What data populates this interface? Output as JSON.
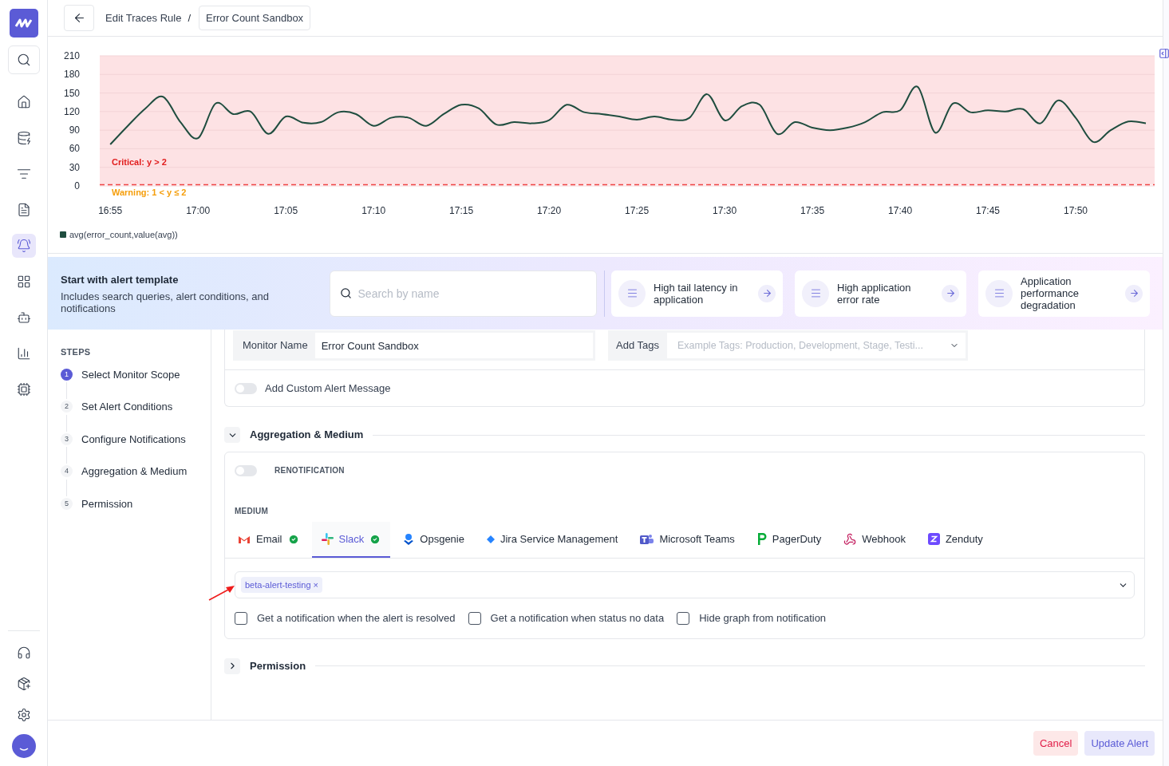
{
  "sidebar": {
    "items": [
      {
        "kind": "search",
        "selected": false
      },
      {
        "kind": "home",
        "selected": false
      },
      {
        "kind": "database",
        "selected": false
      },
      {
        "kind": "logs",
        "selected": false
      },
      {
        "kind": "file",
        "selected": false
      },
      {
        "kind": "alerts",
        "selected": true
      },
      {
        "kind": "dashboards",
        "selected": false
      },
      {
        "kind": "bot",
        "selected": false
      },
      {
        "kind": "reports",
        "selected": false
      },
      {
        "kind": "chip",
        "selected": false
      }
    ],
    "bottom_items": [
      {
        "kind": "support"
      },
      {
        "kind": "package"
      },
      {
        "kind": "settings"
      },
      {
        "kind": "avatar"
      }
    ]
  },
  "header": {
    "breadcrumb": "Edit Traces Rule",
    "separator": "/",
    "title": "Error Count Sandbox"
  },
  "chart_data": {
    "type": "line",
    "categories": [
      "16:55",
      null,
      null,
      null,
      null,
      "17:00",
      null,
      null,
      null,
      null,
      "17:05",
      null,
      null,
      null,
      null,
      "17:10",
      null,
      null,
      null,
      null,
      "17:15",
      null,
      null,
      null,
      null,
      "17:20",
      null,
      null,
      null,
      null,
      "17:25",
      null,
      null,
      null,
      null,
      "17:30",
      null,
      null,
      null,
      null,
      "17:35",
      null,
      null,
      null,
      null,
      "17:40",
      null,
      null,
      null,
      null,
      "17:45",
      null,
      null,
      null,
      null,
      "17:50",
      null,
      null,
      null,
      null
    ],
    "series": [
      {
        "name": "avg(error_count,value(avg))",
        "color": "#1f4d3f",
        "values": [
          67,
          97,
          125,
          144,
          103,
          77,
          133,
          116,
          120,
          84,
          112,
          102,
          103,
          119,
          116,
          97,
          110,
          110,
          97,
          116,
          131,
          125,
          99,
          103,
          101,
          106,
          131,
          119,
          116,
          112,
          107,
          112,
          107,
          110,
          148,
          106,
          129,
          131,
          84,
          103,
          94,
          90,
          94,
          103,
          119,
          122,
          160,
          86,
          133,
          119,
          122,
          120,
          124,
          101,
          138,
          110,
          71,
          90,
          104,
          101
        ]
      }
    ],
    "ylim": [
      0,
      210
    ],
    "yticks": [
      0,
      30,
      60,
      90,
      120,
      150,
      180,
      210
    ],
    "grid": true,
    "annotations": [
      "Critical: y > 2",
      "Warning: 1 < y ≤ 2"
    ]
  },
  "template": {
    "title": "Start with alert template",
    "description": "Includes search queries, alert conditions, and notifications",
    "search_placeholder": "Search by name",
    "items": [
      "High tail latency in application",
      "High application error rate",
      "Application performance degradation"
    ]
  },
  "steps": {
    "title": "STEPS",
    "items": [
      {
        "number": "1",
        "label": "Select Monitor Scope",
        "selected": true
      },
      {
        "number": "2",
        "label": "Set Alert Conditions",
        "selected": false
      },
      {
        "number": "3",
        "label": "Configure Notifications",
        "selected": false
      },
      {
        "number": "4",
        "label": "Aggregation & Medium",
        "selected": false
      },
      {
        "number": "5",
        "label": "Permission",
        "selected": false
      }
    ]
  },
  "monitor_name": {
    "label": "Monitor Name",
    "value": "Error Count Sandbox"
  },
  "tags": {
    "label": "Add Tags",
    "placeholder": "Example Tags: Production, Development, Stage, Testi..."
  },
  "custom_message": {
    "label": "Add Custom Alert Message",
    "on": false
  },
  "aggregation": {
    "title": "Aggregation & Medium",
    "expanded": true
  },
  "renotification": {
    "label": "RENOTIFICATION",
    "on": false
  },
  "medium": {
    "label": "MEDIUM"
  },
  "channels": [
    {
      "kind": "email",
      "name": "Email",
      "configured": true,
      "selected": false
    },
    {
      "kind": "slack",
      "name": "Slack",
      "configured": true,
      "selected": true
    },
    {
      "kind": "opsgenie",
      "name": "Opsgenie",
      "configured": false,
      "selected": false
    },
    {
      "kind": "jira",
      "name": "Jira Service Management",
      "configured": false,
      "selected": false
    },
    {
      "kind": "teams",
      "name": "Microsoft Teams",
      "configured": false,
      "selected": false
    },
    {
      "kind": "pagerduty",
      "name": "PagerDuty",
      "configured": false,
      "selected": false
    },
    {
      "kind": "webhook",
      "name": "Webhook",
      "configured": false,
      "selected": false
    },
    {
      "kind": "zenduty",
      "name": "Zenduty",
      "configured": false,
      "selected": false
    }
  ],
  "channel_select": {
    "chips": [
      {
        "label": "beta-alert-testing",
        "remove": "×"
      }
    ]
  },
  "checkboxes": [
    {
      "label": "Get a notification when the alert is resolved",
      "checked": false
    },
    {
      "label": "Get a notification when status no data",
      "checked": false
    },
    {
      "label": "Hide graph from notification",
      "checked": false
    }
  ],
  "permission": {
    "title": "Permission",
    "expanded": false
  },
  "footer": {
    "cancel": "Cancel",
    "submit": "Update Alert"
  }
}
